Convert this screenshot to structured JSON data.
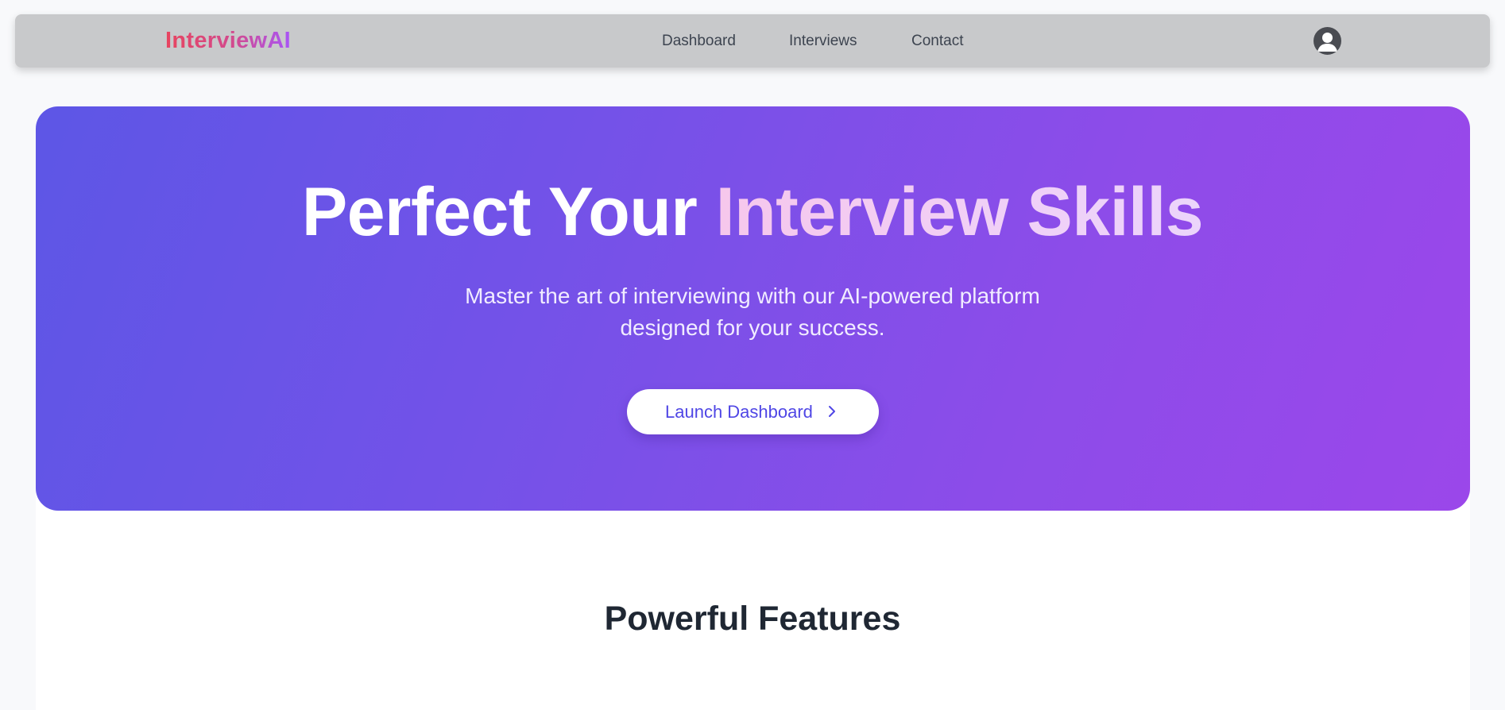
{
  "navbar": {
    "logo": "InterviewAI",
    "links": [
      {
        "label": "Dashboard"
      },
      {
        "label": "Interviews"
      },
      {
        "label": "Contact"
      }
    ],
    "avatar_icon": "user-circle-icon"
  },
  "hero": {
    "title_main": "Perfect Your",
    "title_accent": "Interview Skills",
    "subtitle_line1": "Master the art of interviewing with our AI-powered platform",
    "subtitle_line2": "designed for your success.",
    "cta_label": "Launch Dashboard",
    "cta_icon": "chevron-right-icon"
  },
  "features": {
    "title": "Powerful Features"
  },
  "colors": {
    "brand_gradient_start": "#5d56e6",
    "brand_gradient_end": "#9b47ea",
    "logo_start": "#e8445f",
    "logo_end": "#a855f7",
    "cta_text": "#4f46e5"
  }
}
